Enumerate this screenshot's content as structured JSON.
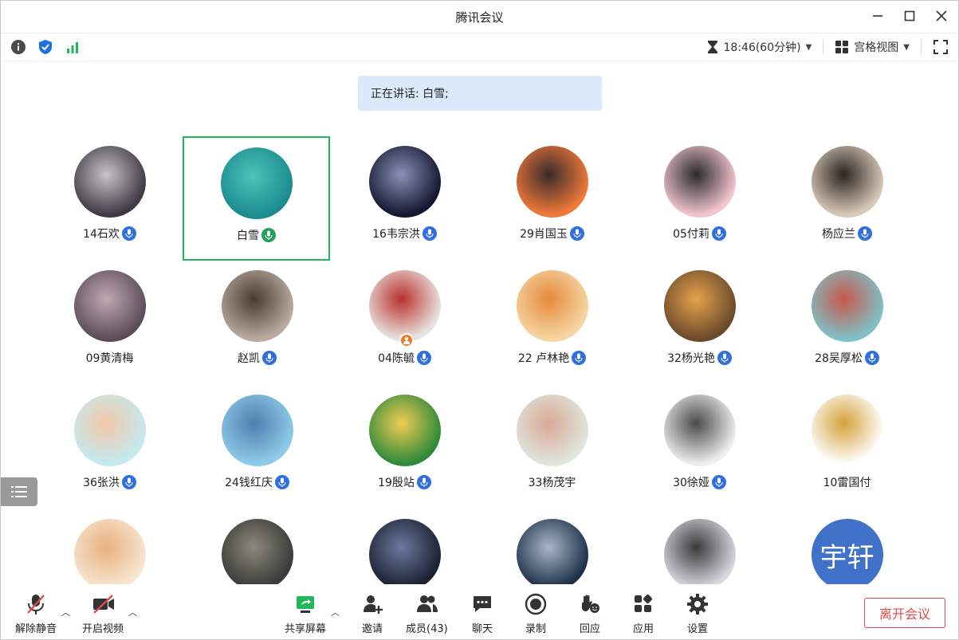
{
  "window": {
    "title": "腾讯会议"
  },
  "toolbar": {
    "time": "18:46(60分钟)",
    "view_label": "宫格视图"
  },
  "speaking": "正在讲话: 白雪;",
  "participants": [
    {
      "name": "14石欢",
      "mic": "on",
      "avatar_colors": [
        "#3d3a44",
        "#c9c3c8"
      ]
    },
    {
      "name": "白雪",
      "mic": "speaking",
      "avatar_colors": [
        "#1b8b8f",
        "#4fc2b8"
      ],
      "active": true
    },
    {
      "name": "16韦宗洪",
      "mic": "on",
      "avatar_colors": [
        "#151630",
        "#8a92b8"
      ]
    },
    {
      "name": "29肖国玉",
      "mic": "on",
      "avatar_colors": [
        "#f07a3a",
        "#3a2a2a"
      ]
    },
    {
      "name": "05付莉",
      "mic": "on",
      "avatar_colors": [
        "#f3c6cf",
        "#2b2b2b"
      ]
    },
    {
      "name": "杨应兰",
      "mic": "on",
      "avatar_colors": [
        "#d9c9b9",
        "#2c2420"
      ]
    },
    {
      "name": "09黄清梅",
      "mic": "none",
      "avatar_colors": [
        "#5a4c56",
        "#c2a9b2"
      ]
    },
    {
      "name": "赵凯",
      "mic": "on",
      "avatar_colors": [
        "#b9aba0",
        "#4a3a32"
      ]
    },
    {
      "name": "04陈毓",
      "mic": "on",
      "avatar_colors": [
        "#e9e4e2",
        "#b9302c"
      ],
      "host": true
    },
    {
      "name": "22 卢林艳",
      "mic": "on",
      "avatar_colors": [
        "#f6d6a4",
        "#e58a3d"
      ]
    },
    {
      "name": "32杨光艳",
      "mic": "on",
      "avatar_colors": [
        "#6a4a2a",
        "#e6a24c"
      ]
    },
    {
      "name": "28吴厚松",
      "mic": "on",
      "avatar_colors": [
        "#7ec2c8",
        "#c8584a"
      ]
    },
    {
      "name": "36张洪",
      "mic": "on",
      "avatar_colors": [
        "#c2eaf0",
        "#f4c8a8"
      ]
    },
    {
      "name": "24钱红庆",
      "mic": "on",
      "avatar_colors": [
        "#8ecbe8",
        "#4f7fb0"
      ]
    },
    {
      "name": "19殷站",
      "mic": "on",
      "avatar_colors": [
        "#2d8a3a",
        "#f1cc52"
      ]
    },
    {
      "name": "33杨茂宇",
      "mic": "none",
      "avatar_colors": [
        "#dfe6dc",
        "#d9a998"
      ]
    },
    {
      "name": "30徐娅",
      "mic": "on",
      "avatar_colors": [
        "#eeeeee",
        "#4a4a4a"
      ]
    },
    {
      "name": "10雷国付",
      "mic": "none",
      "avatar_colors": [
        "#ffffff",
        "#d4a23a"
      ]
    },
    {
      "name": "",
      "mic": "none",
      "avatar_colors": [
        "#f7e6d0",
        "#e8b080"
      ]
    },
    {
      "name": "",
      "mic": "none",
      "avatar_colors": [
        "#3a3a3a",
        "#8a8a7a"
      ]
    },
    {
      "name": "",
      "mic": "none",
      "avatar_colors": [
        "#1c2030",
        "#6a7aa0"
      ]
    },
    {
      "name": "",
      "mic": "none",
      "avatar_colors": [
        "#1e3048",
        "#a8b8c8"
      ]
    },
    {
      "name": "",
      "mic": "none",
      "avatar_colors": [
        "#d8d8e0",
        "#3a3a3a"
      ]
    },
    {
      "name": "",
      "mic": "none",
      "avatar_text": "宇轩",
      "avatar_colors": [
        "#3f72c8",
        "#3f72c8"
      ]
    }
  ],
  "bottom": {
    "mute": "解除静音",
    "video": "开启视频",
    "share": "共享屏幕",
    "invite": "邀请",
    "members": "成员(43)",
    "chat": "聊天",
    "record": "录制",
    "react": "回应",
    "apps": "应用",
    "settings": "设置",
    "leave": "离开会议"
  },
  "colors": {
    "accent_green": "#21b85c",
    "mic_blue": "#2f6fe0",
    "leave_red": "#e04a4a",
    "banner_bg": "#dbe9fb"
  }
}
